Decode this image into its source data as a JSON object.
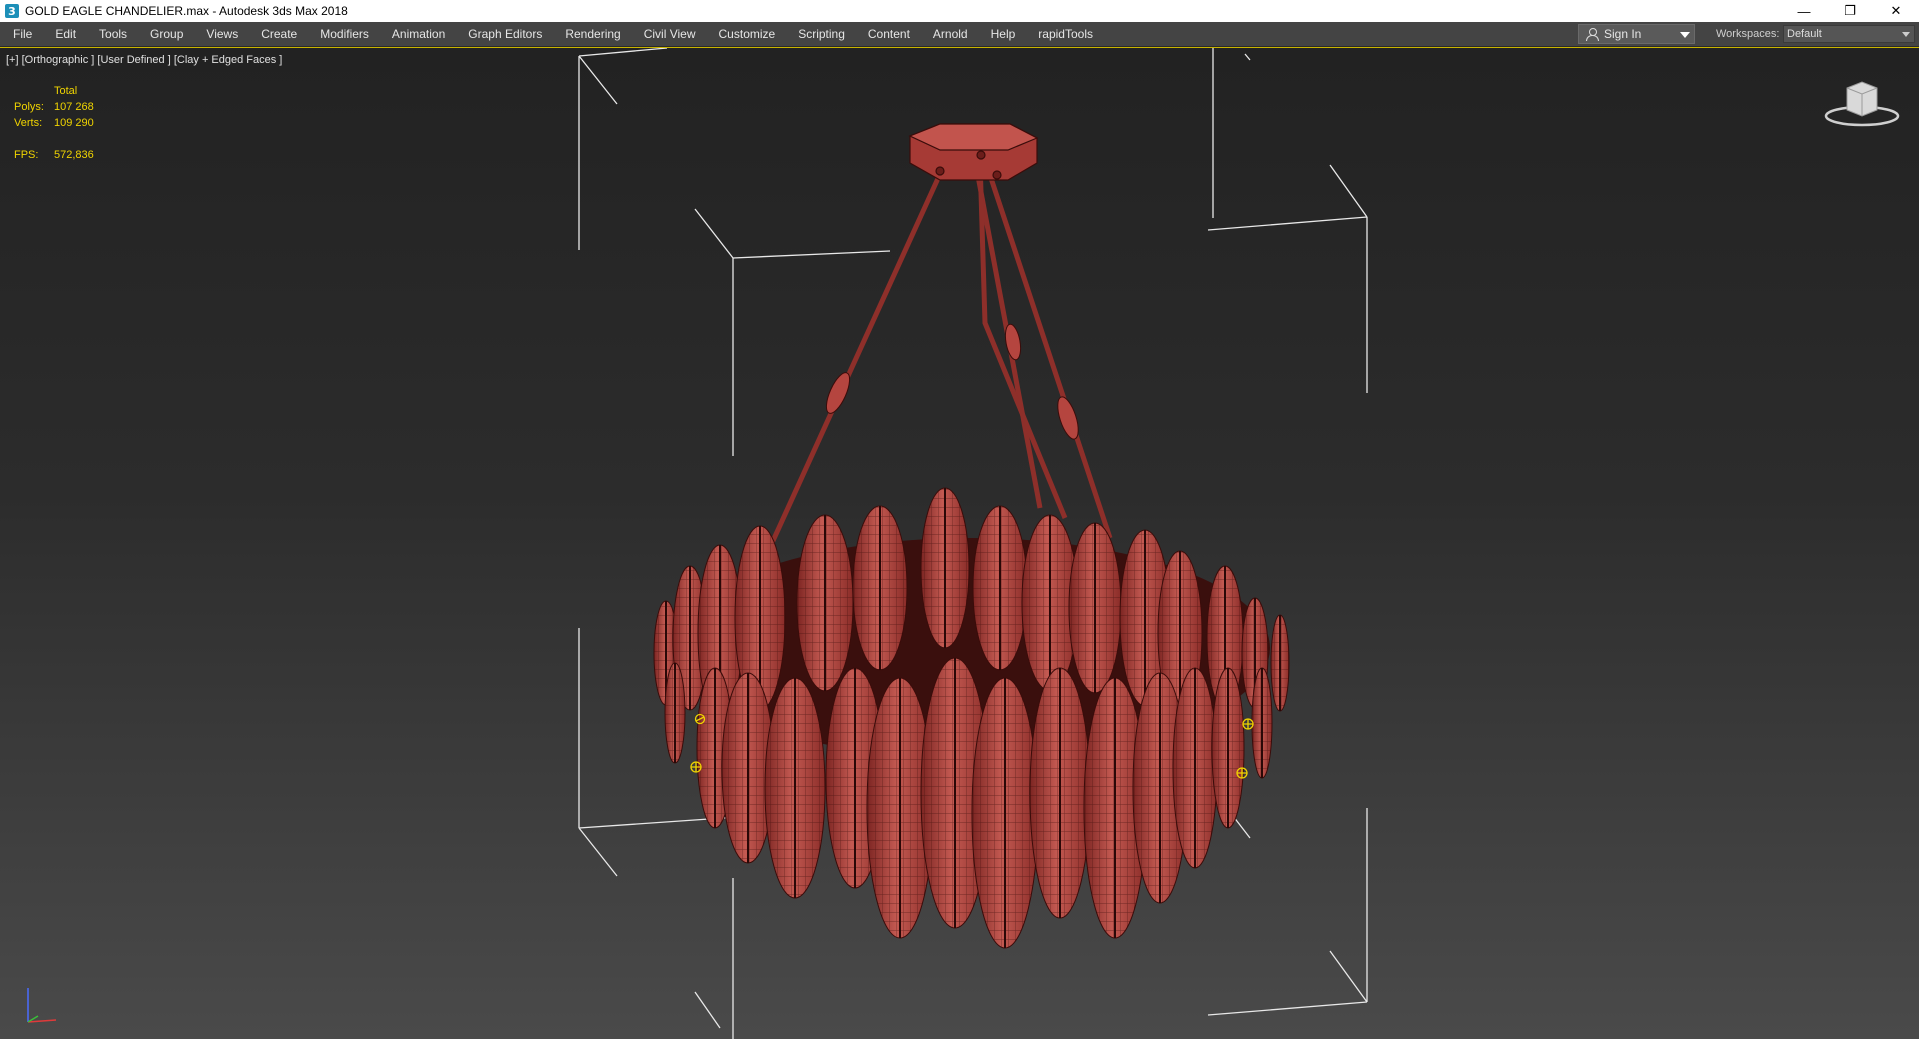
{
  "window": {
    "title": "GOLD EAGLE CHANDELIER.max - Autodesk 3ds Max 2018",
    "app_icon": "3",
    "controls": {
      "minimize": "—",
      "restore": "❐",
      "close": "✕"
    }
  },
  "menubar": {
    "items": [
      "File",
      "Edit",
      "Tools",
      "Group",
      "Views",
      "Create",
      "Modifiers",
      "Animation",
      "Graph Editors",
      "Rendering",
      "Civil View",
      "Customize",
      "Scripting",
      "Content",
      "Arnold",
      "Help",
      "rapidTools"
    ],
    "sign_in": "Sign In",
    "workspaces_label": "Workspaces:",
    "workspace_value": "Default"
  },
  "viewport": {
    "label": "[+] [Orthographic ] [User Defined ] [Clay + Edged Faces ]",
    "stats": {
      "header": "Total",
      "polys_label": "Polys:",
      "polys_value": "107 268",
      "verts_label": "Verts:",
      "verts_value": "109 290",
      "fps_label": "FPS:",
      "fps_value": "572,836"
    },
    "model_color": "#b5453f",
    "wire_color": "#3a0c0a",
    "bbox_color": "#e8e8e8",
    "stats_color": "#f0d400"
  }
}
